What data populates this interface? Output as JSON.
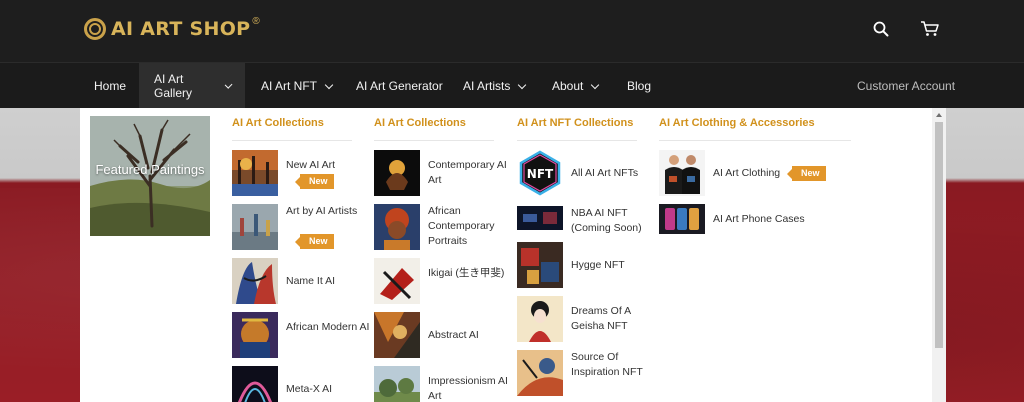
{
  "brand": {
    "name": "AI ART SHOP",
    "reg": "®"
  },
  "header": {
    "search_icon": "search-icon",
    "cart_icon": "cart-icon"
  },
  "nav": {
    "items": [
      {
        "label": "Home",
        "dropdown": false
      },
      {
        "label": "AI Art Gallery",
        "dropdown": true,
        "active": true
      },
      {
        "label": "AI Art NFT",
        "dropdown": true
      },
      {
        "label": "AI Art Generator",
        "dropdown": false
      },
      {
        "label": "AI Artists",
        "dropdown": true
      },
      {
        "label": "About",
        "dropdown": true
      },
      {
        "label": "Blog",
        "dropdown": false
      }
    ],
    "account": "Customer Account"
  },
  "mega": {
    "featured": {
      "label": "Featured Paintings"
    },
    "columns": [
      {
        "title": "AI Art Collections",
        "items": [
          {
            "label": "New AI Art",
            "badge": "New"
          },
          {
            "label": "Art by AI Artists",
            "badge": "New"
          },
          {
            "label": "Name It AI"
          },
          {
            "label": "African Modern AI"
          },
          {
            "label": "Meta-X AI"
          }
        ]
      },
      {
        "title": "AI Art Collections",
        "items": [
          {
            "label": "Contemporary AI Art"
          },
          {
            "label": "African Contemporary Portraits"
          },
          {
            "label": "Ikigai (生き甲斐)"
          },
          {
            "label": "Abstract AI"
          },
          {
            "label": "Impressionism AI Art"
          }
        ]
      },
      {
        "title": "AI Art NFT Collections",
        "items": [
          {
            "label": "All AI Art NFTs"
          },
          {
            "label": "NBA AI NFT (Coming Soon)"
          },
          {
            "label": "Hygge NFT"
          },
          {
            "label": "Dreams Of A Geisha NFT"
          },
          {
            "label": "Source Of Inspiration NFT"
          }
        ]
      },
      {
        "title": "AI Art Clothing & Accessories",
        "items": [
          {
            "label": "AI Art Clothing",
            "badge": "New"
          },
          {
            "label": "AI Art Phone Cases"
          }
        ]
      }
    ]
  }
}
